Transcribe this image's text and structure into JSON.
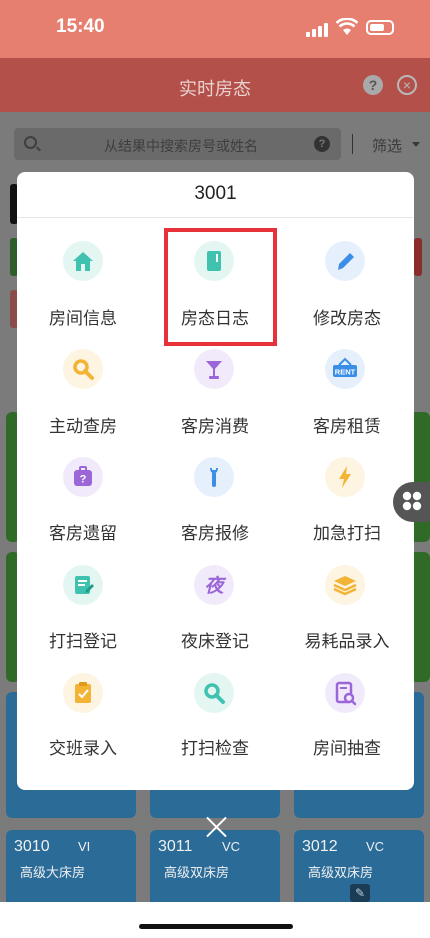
{
  "status_bar": {
    "time": "15:40"
  },
  "header": {
    "title": "实时房态"
  },
  "search": {
    "placeholder": "从结果中搜索房号或姓名",
    "help_label": "?",
    "filter_label": "筛选"
  },
  "room_cards": [
    {
      "number": "3010",
      "code": "VI",
      "type": "高级大床房"
    },
    {
      "number": "3011",
      "code": "VC",
      "type": "高级双床房"
    },
    {
      "number": "3012",
      "code": "VC",
      "type": "高级双床房"
    }
  ],
  "modal": {
    "title": "3001",
    "tiles": [
      {
        "label": "房间信息",
        "icon": "home-icon"
      },
      {
        "label": "房态日志",
        "icon": "notebook-icon"
      },
      {
        "label": "修改房态",
        "icon": "pencil-icon"
      },
      {
        "label": "主动查房",
        "icon": "magnifier-icon"
      },
      {
        "label": "客房消费",
        "icon": "cocktail-glass-icon"
      },
      {
        "label": "客房租赁",
        "icon": "rent-sign-icon",
        "icon_text": "RENT"
      },
      {
        "label": "客房遗留",
        "icon": "lost-bag-icon",
        "icon_text": "?"
      },
      {
        "label": "客房报修",
        "icon": "wrench-icon"
      },
      {
        "label": "加急打扫",
        "icon": "lightning-icon"
      },
      {
        "label": "打扫登记",
        "icon": "edit-document-icon"
      },
      {
        "label": "夜床登记",
        "icon": "night-bed-icon",
        "icon_text": "夜"
      },
      {
        "label": "易耗品录入",
        "icon": "stack-icon"
      },
      {
        "label": "交班录入",
        "icon": "clipboard-icon"
      },
      {
        "label": "打扫检查",
        "icon": "search-check-icon"
      },
      {
        "label": "房间抽查",
        "icon": "doc-search-icon"
      }
    ]
  },
  "colors": {
    "status_bar": "#e77f70",
    "header": "#b35049",
    "highlight_border": "#e8323a",
    "teal": "#3fc3b0",
    "blue": "#3a8ee6",
    "amber": "#f3b436",
    "purple": "#9a66d8"
  }
}
